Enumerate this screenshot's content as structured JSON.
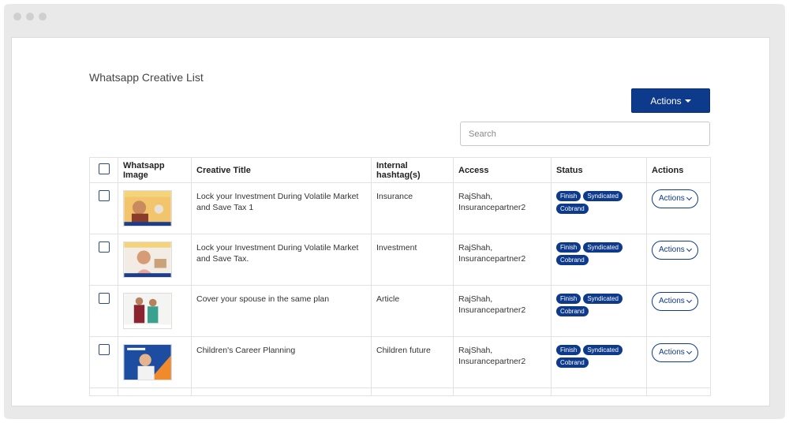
{
  "page": {
    "title": "Whatsapp Creative List"
  },
  "toolbar": {
    "actions_label": "Actions"
  },
  "search": {
    "placeholder": "Search"
  },
  "table": {
    "headers": [
      "Whatsapp Image",
      "Creative Title",
      "Internal hashtag(s)",
      "Access",
      "Status",
      "Actions"
    ],
    "rows": [
      {
        "title": "Lock your Investment During Volatile Market and Save Tax 1",
        "hashtag": "Insurance",
        "access": "RajShah, Insurancepartner2",
        "badges": [
          "Finish",
          "Syndicated",
          "Cobrand"
        ],
        "action": "Actions"
      },
      {
        "title": "Lock your Investment During Volatile Market and Save Tax.",
        "hashtag": "Investment",
        "access": "RajShah, Insurancepartner2",
        "badges": [
          "Finish",
          "Syndicated",
          "Cobrand"
        ],
        "action": "Actions"
      },
      {
        "title": "Cover your spouse in the same plan",
        "hashtag": "Article",
        "access": "RajShah, Insurancepartner2",
        "badges": [
          "Finish",
          "Syndicated",
          "Cobrand"
        ],
        "action": "Actions"
      },
      {
        "title": "Children's Career Planning",
        "hashtag": "Children future",
        "access": "RajShah, Insurancepartner2",
        "badges": [
          "Finish",
          "Syndicated",
          "Cobrand"
        ],
        "action": "Actions"
      }
    ]
  },
  "colors": {
    "brand": "#0e3a8c"
  }
}
